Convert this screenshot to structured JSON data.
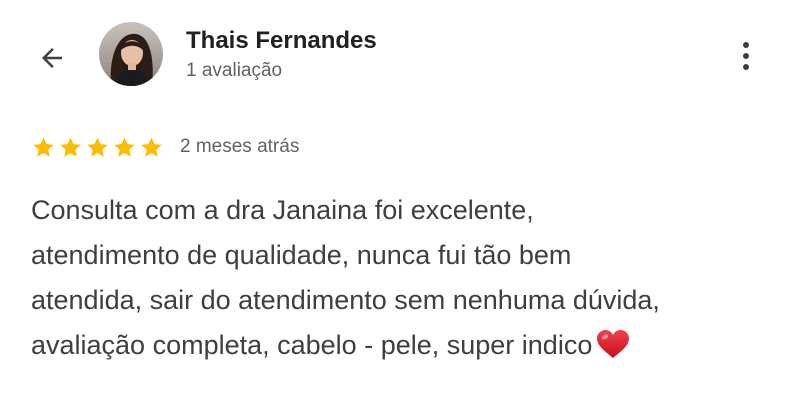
{
  "review": {
    "author_name": "Thais Fernandes",
    "author_meta": "1 avaliação",
    "rating": 5,
    "rating_max": 5,
    "date": "2 meses atrás",
    "lines": [
      "Consulta com a dra Janaina foi excelente,",
      "atendimento de qualidade, nunca fui tão bem",
      "atendida, sair do atendimento sem nenhuma dúvida,",
      "avaliação completa, cabelo - pele, super indico"
    ],
    "trailing_emoji": "heart-emoji"
  },
  "icons": {
    "back": "arrow-left-icon",
    "more": "more-vertical-icon",
    "star": "star-icon",
    "heart": "heart-icon"
  },
  "colors": {
    "star": "#fbbc04",
    "text": "#3c4043",
    "meta": "#5f6368",
    "heart": "#e0202b"
  }
}
